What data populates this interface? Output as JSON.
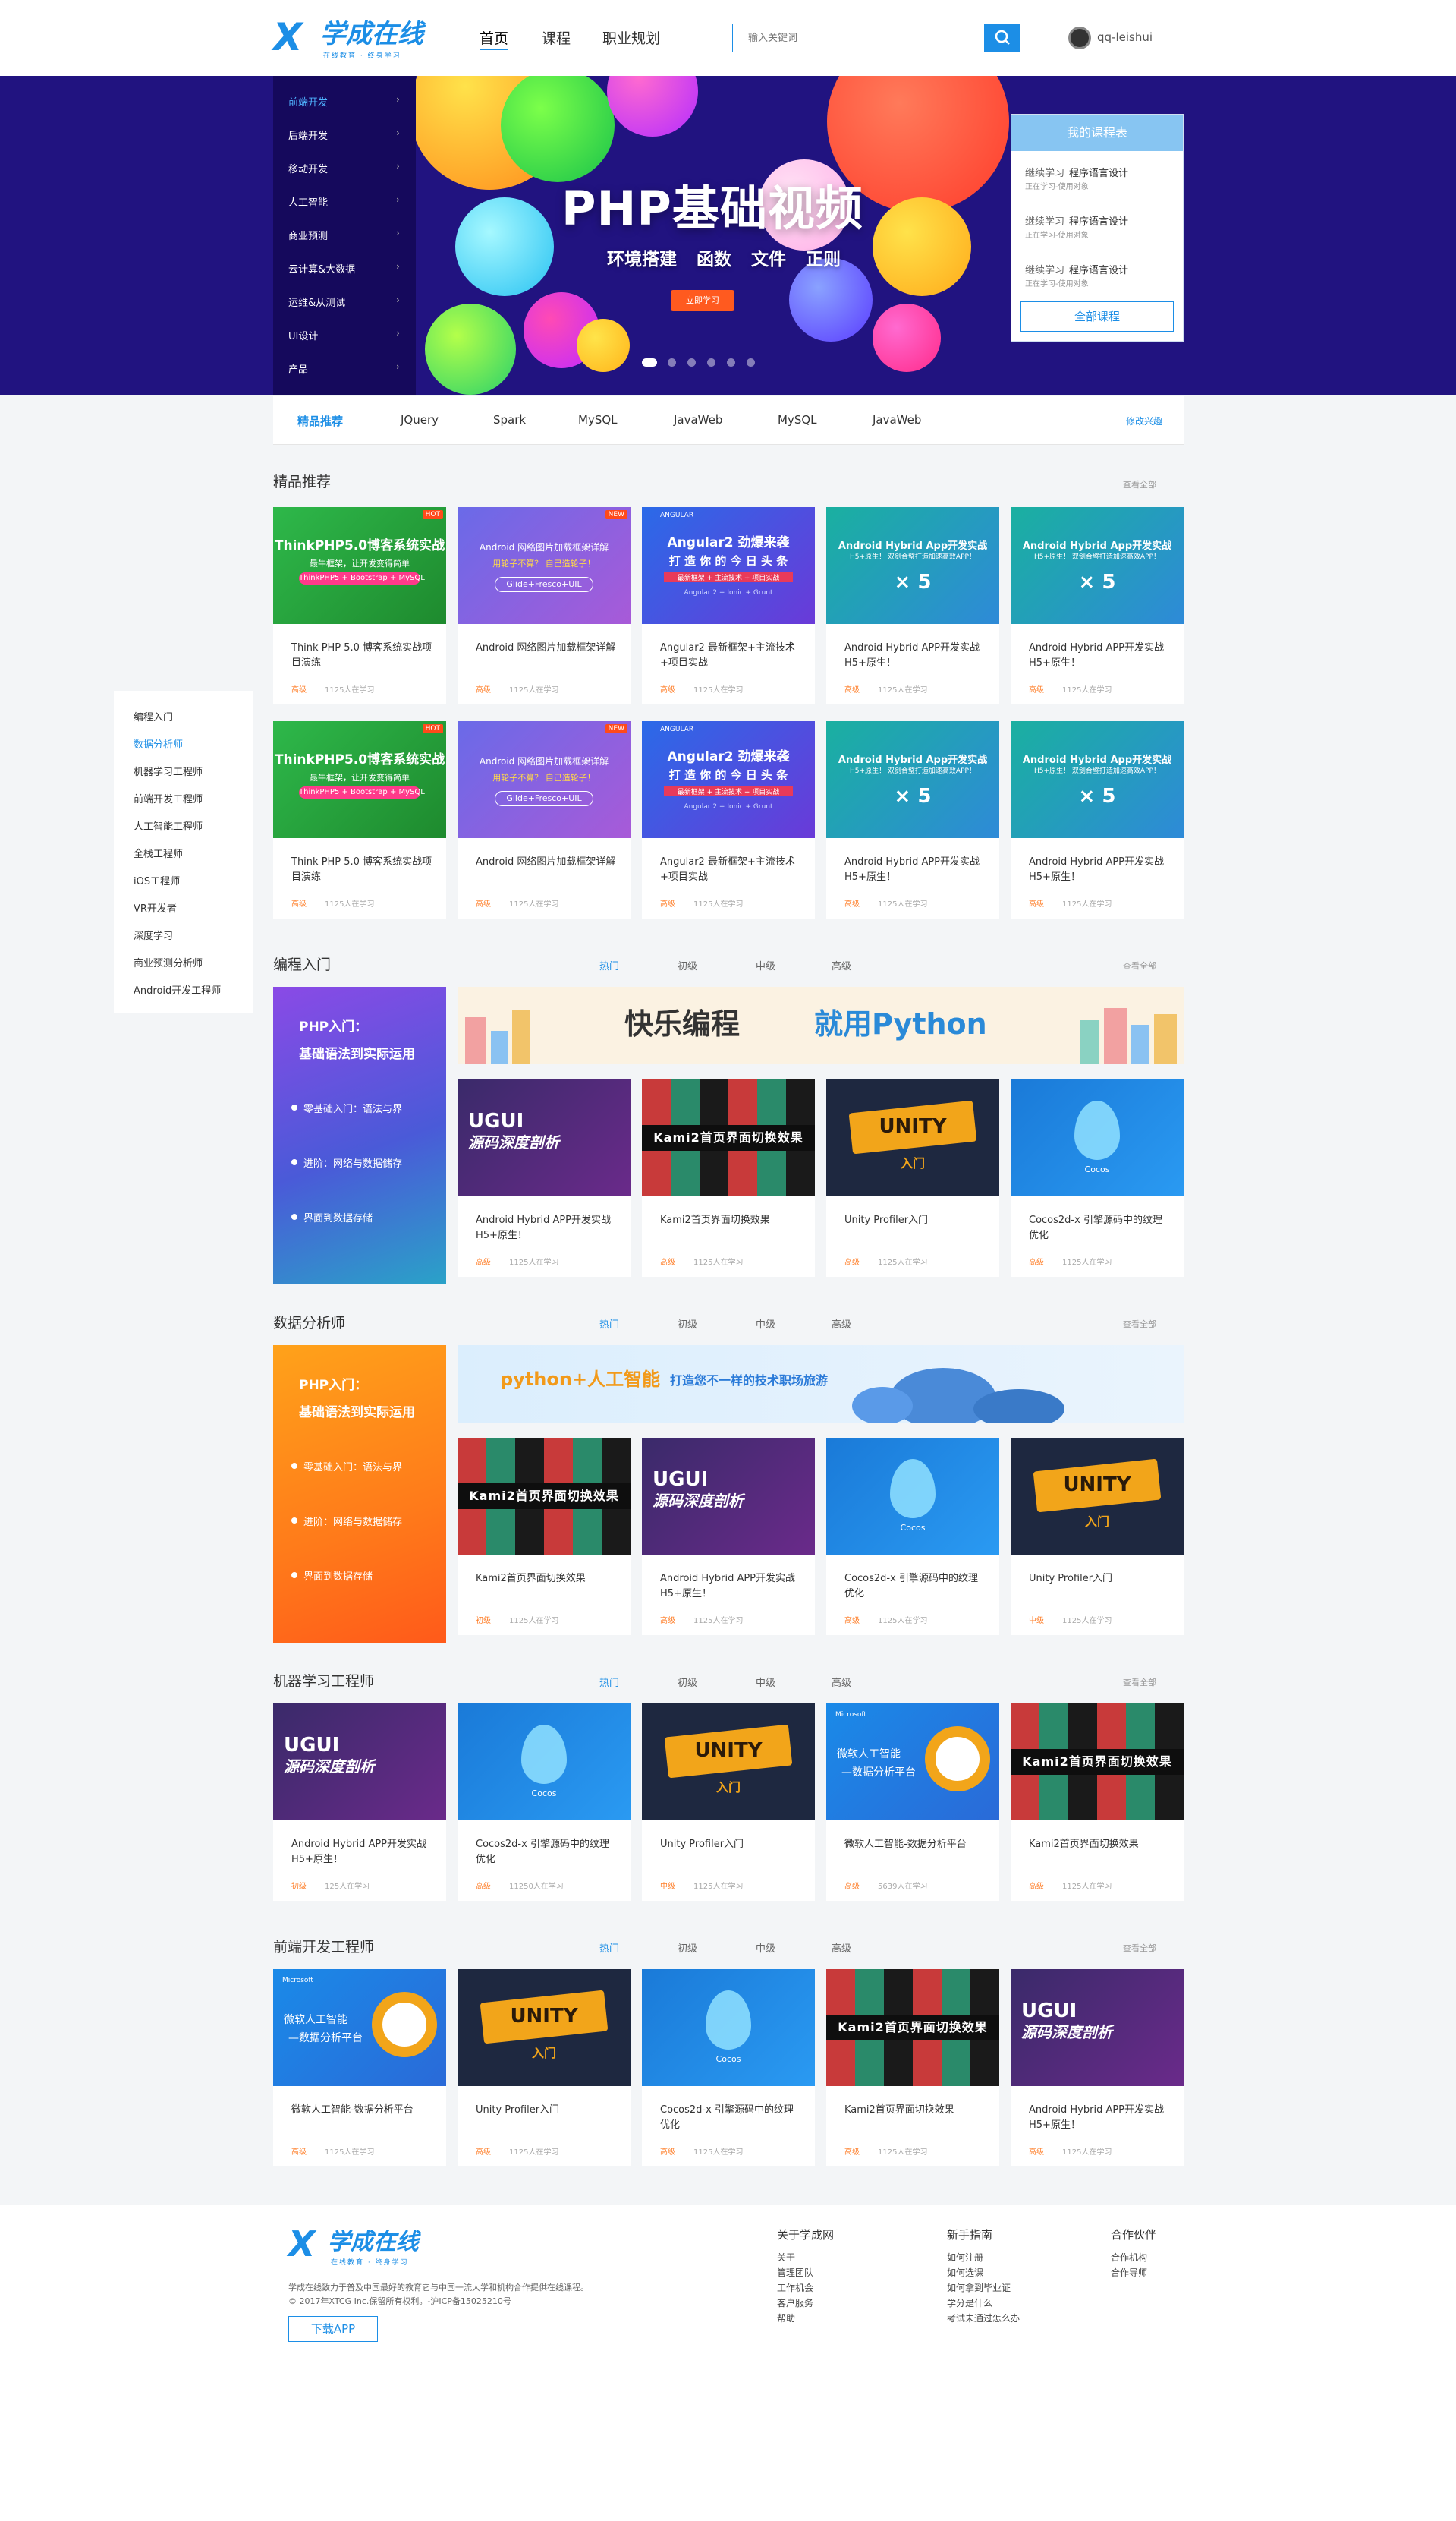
{
  "brand": {
    "name": "学成在线",
    "mark": "X",
    "slogan": "在线教育 · 终身学习"
  },
  "nav": [
    "首页",
    "课程",
    "职业规划"
  ],
  "search": {
    "placeholder": "输入关键词"
  },
  "user": {
    "name": "qq-leishui"
  },
  "colors": {
    "primary": "#1c8ee6",
    "banner_bg": "#211380",
    "sidebar_bg": "#15095c",
    "hot": "#ff4a1a",
    "level": "#ff7f2a"
  },
  "categories": [
    "前端开发",
    "后端开发",
    "移动开发",
    "人工智能",
    "商业预测",
    "云计算&大数据",
    "运维&从测试",
    "UI设计",
    "产品"
  ],
  "hero": {
    "title": "PHP基础视频",
    "subtitle": "环境搭建 函数 文件 正则",
    "button": "立即学习"
  },
  "my_courses": {
    "title": "我的课程表",
    "items": [
      {
        "action": "继续学习",
        "name": "程序语言设计",
        "meta": "正在学习-使用对象"
      },
      {
        "action": "继续学习",
        "name": "程序语言设计",
        "meta": "正在学习-使用对象"
      },
      {
        "action": "继续学习",
        "name": "程序语言设计",
        "meta": "正在学习-使用对象"
      }
    ],
    "all": "全部课程"
  },
  "tags": {
    "items": [
      "精品推荐",
      "JQuery",
      "Spark",
      "MySQL",
      "JavaWeb",
      "MySQL",
      "JavaWeb"
    ],
    "edit": "修改兴趣"
  },
  "sidenav": [
    "编程入门",
    "数据分析师",
    "机器学习工程师",
    "前端开发工程师",
    "人工智能工程师",
    "全栈工程师",
    "iOS工程师",
    "VR开发者",
    "深度学习",
    "商业预测分析师",
    "Android开发工程师"
  ],
  "common": {
    "more": "查看全部",
    "level": "高级",
    "count": "1125人在学习"
  },
  "level_tabs": [
    "热门",
    "初级",
    "中级",
    "高级"
  ],
  "thumbs": {
    "thinkphp": {
      "t1": "ThinkPHP5.0博客系统实战",
      "t2": "最牛框架，让开发变得简单",
      "t3": "ThinkPHP5 + Bootstrap + MySQL",
      "badge": "HOT"
    },
    "android_img": {
      "t1": "Android 网络图片加载框架详解",
      "t2": "用轮子不算？ 自己造轮子！",
      "t3": "Glide+Fresco+UIL",
      "badge": "NEW"
    },
    "angular": {
      "t0": "ANGULAR",
      "t1": "Angular2 劲爆来袭",
      "t2": "打 造 你 的 今 日 头 条",
      "t3": "最新框架 + 主流技术 + 项目实战",
      "t4": "Angular 2 + Ionic + Grunt"
    },
    "hybrid": {
      "t1": "Android Hybrid App开发实战",
      "t2": "H5+原生！ 双剑合璧打造加速高效APP！"
    },
    "ugui": {
      "t1": "UGUI",
      "t2": "源码深度剖析"
    },
    "kami": {
      "t1": "Kami2首页界面切换效果"
    },
    "unity": {
      "t1": "UNITY",
      "t2": "入门"
    },
    "cocos": {
      "t1": "Cocos"
    },
    "microsoft": {
      "t0": "Microsoft",
      "t1": "微软人工智能",
      "t2": "—数据分析平台"
    }
  },
  "sec_featured": {
    "title": "精品推荐",
    "row1": [
      {
        "thumb": "thinkphp",
        "title": "Think PHP 5.0 博客系统实战项目演练"
      },
      {
        "thumb": "android_img",
        "title": "Android 网络图片加载框架详解"
      },
      {
        "thumb": "angular",
        "title": "Angular2 最新框架+主流技术+项目实战"
      },
      {
        "thumb": "hybrid",
        "title": "Android Hybrid APP开发实战 H5+原生！"
      },
      {
        "thumb": "hybrid",
        "title": "Android Hybrid APP开发实战 H5+原生！"
      }
    ],
    "row2": [
      {
        "thumb": "thinkphp",
        "title": "Think PHP 5.0 博客系统实战项目演练"
      },
      {
        "thumb": "android_img",
        "title": "Android 网络图片加载框架详解"
      },
      {
        "thumb": "angular",
        "title": "Angular2 最新框架+主流技术+项目实战"
      },
      {
        "thumb": "hybrid",
        "title": "Android Hybrid APP开发实战 H5+原生！"
      },
      {
        "thumb": "hybrid",
        "title": "Android Hybrid APP开发实战 H5+原生！"
      }
    ]
  },
  "sec_coding": {
    "title": "编程入门",
    "promo": {
      "t1": "PHP入门：",
      "t2": "基础语法到实际运用",
      "items": [
        "零基础入门：语法与界",
        "进阶：网络与数据储存",
        "界面到数据存储"
      ]
    },
    "banner": {
      "t1": "快乐编程",
      "t2": "就用Python"
    },
    "cards": [
      {
        "thumb": "ugui",
        "title": "Android Hybrid APP开发实战 H5+原生！",
        "level": "高级",
        "count": "1125人在学习"
      },
      {
        "thumb": "kami",
        "title": "Kami2首页界面切换效果",
        "level": "高级",
        "count": "1125人在学习"
      },
      {
        "thumb": "unity",
        "title": "Unity Profiler入门",
        "level": "高级",
        "count": "1125人在学习"
      },
      {
        "thumb": "cocos",
        "title": "Cocos2d-x 引擎源码中的纹理优化",
        "level": "高级",
        "count": "1125人在学习"
      }
    ]
  },
  "sec_data": {
    "title": "数据分析师",
    "promo": {
      "t1": "PHP入门：",
      "t2": "基础语法到实际运用",
      "items": [
        "零基础入门：语法与界",
        "进阶：网络与数据储存",
        "界面到数据存储"
      ]
    },
    "banner": {
      "t1": "python+人工智能",
      "t2": "打造您不一样的技术职场旅游"
    },
    "cards": [
      {
        "thumb": "kami",
        "title": "Kami2首页界面切换效果",
        "level": "初级",
        "count": "1125人在学习"
      },
      {
        "thumb": "ugui",
        "title": "Android Hybrid APP开发实战 H5+原生！",
        "level": "高级",
        "count": "1125人在学习"
      },
      {
        "thumb": "cocos",
        "title": "Cocos2d-x 引擎源码中的纹理优化",
        "level": "高级",
        "count": "1125人在学习"
      },
      {
        "thumb": "unity",
        "title": "Unity Profiler入门",
        "level": "中级",
        "count": "1125人在学习"
      }
    ]
  },
  "sec_ml": {
    "title": "机器学习工程师",
    "cards": [
      {
        "thumb": "ugui",
        "title": "Android Hybrid APP开发实战 H5+原生！",
        "level": "初级",
        "count": "125人在学习"
      },
      {
        "thumb": "cocos",
        "title": "Cocos2d-x 引擎源码中的纹理优化",
        "level": "高级",
        "count": "11250人在学习"
      },
      {
        "thumb": "unity",
        "title": "Unity Profiler入门",
        "level": "中级",
        "count": "1125人在学习"
      },
      {
        "thumb": "microsoft",
        "title": "微软人工智能-数据分析平台",
        "level": "高级",
        "count": "5639人在学习"
      },
      {
        "thumb": "kami",
        "title": "Kami2首页界面切换效果",
        "level": "高级",
        "count": "1125人在学习"
      }
    ]
  },
  "sec_fe": {
    "title": "前端开发工程师",
    "cards": [
      {
        "thumb": "microsoft",
        "title": "微软人工智能-数据分析平台",
        "level": "高级",
        "count": "1125人在学习"
      },
      {
        "thumb": "unity",
        "title": "Unity Profiler入门",
        "level": "高级",
        "count": "1125人在学习"
      },
      {
        "thumb": "cocos",
        "title": "Cocos2d-x 引擎源码中的纹理优化",
        "level": "高级",
        "count": "1125人在学习"
      },
      {
        "thumb": "kami",
        "title": "Kami2首页界面切换效果",
        "level": "高级",
        "count": "1125人在学习"
      },
      {
        "thumb": "ugui",
        "title": "Android Hybrid APP开发实战 H5+原生！",
        "level": "高级",
        "count": "1125人在学习"
      }
    ]
  },
  "footer": {
    "about": "学成在线致力于普及中国最好的教育它与中国一流大学和机构合作提供在线课程。",
    "copyright": "© 2017年XTCG Inc.保留所有权利。-沪ICP备15025210号",
    "app_button": "下载APP",
    "cols": [
      {
        "title": "关于学成网",
        "links": [
          "关于",
          "管理团队",
          "工作机会",
          "客户服务",
          "帮助"
        ]
      },
      {
        "title": "新手指南",
        "links": [
          "如何注册",
          "如何选课",
          "如何拿到毕业证",
          "学分是什么",
          "考试未通过怎么办"
        ]
      },
      {
        "title": "合作伙伴",
        "links": [
          "合作机构",
          "合作导师"
        ]
      }
    ]
  }
}
